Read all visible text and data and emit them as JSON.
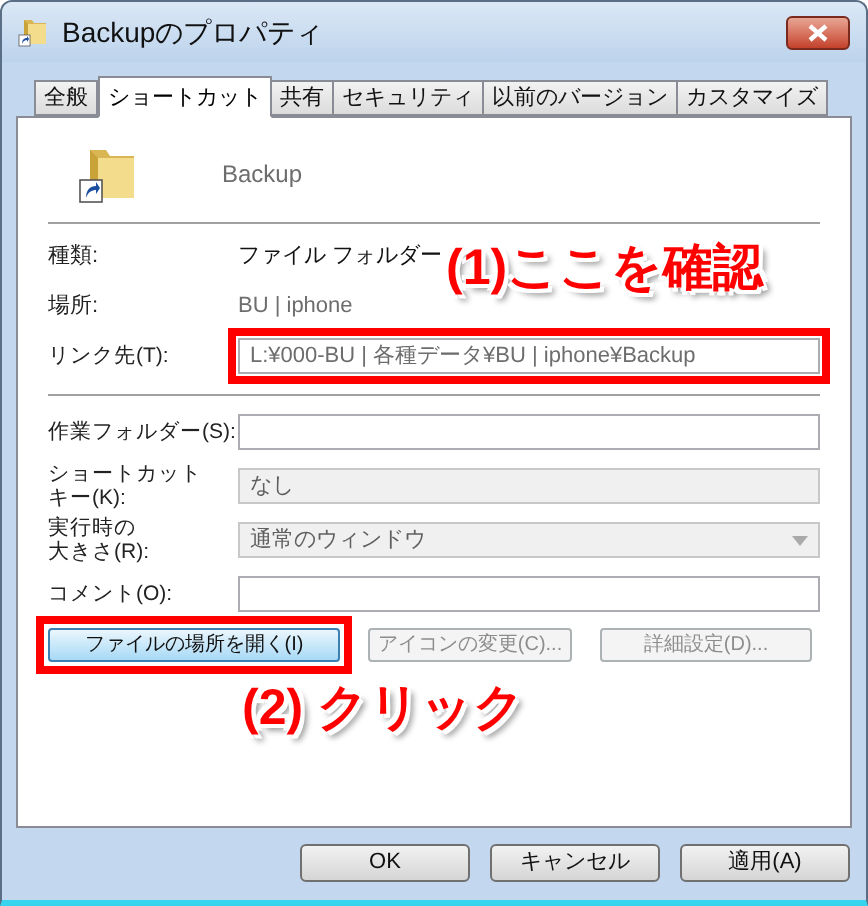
{
  "window": {
    "title": "Backupのプロパティ"
  },
  "tabs": [
    {
      "label": "全般",
      "selected": false
    },
    {
      "label": "ショートカット",
      "selected": true
    },
    {
      "label": "共有",
      "selected": false
    },
    {
      "label": "セキュリティ",
      "selected": false
    },
    {
      "label": "以前のバージョン",
      "selected": false
    },
    {
      "label": "カスタマイズ",
      "selected": false
    }
  ],
  "item": {
    "name": "Backup"
  },
  "properties": [
    {
      "label": "種類:",
      "value": "ファイル フォルダー",
      "dimmed": false
    },
    {
      "label": "場所:",
      "value": "BU | iphone",
      "dimmed": true
    }
  ],
  "fields": [
    {
      "kind": "text",
      "label": [
        "リンク先(T):"
      ],
      "value": "L:¥000-BU | 各種データ¥BU | iphone¥Backup",
      "disabled": false,
      "highlighted": true
    },
    {
      "kind": "text",
      "label": [
        "作業フォルダー(S):"
      ],
      "disabled": false,
      "highlighted": false
    },
    {
      "kind": "text",
      "label": [
        "ショートカット",
        "キー(K):"
      ],
      "value": "なし",
      "disabled": true,
      "highlighted": false
    },
    {
      "kind": "dropdown",
      "label": [
        "実行時の",
        "大きさ(R):"
      ],
      "value": "通常のウィンドウ",
      "disabled": true,
      "highlighted": false
    },
    {
      "kind": "text",
      "label": [
        "コメント(O):"
      ],
      "disabled": false,
      "highlighted": false
    }
  ],
  "actions": [
    {
      "label": "ファイルの場所を開く(I)",
      "disabled": false,
      "highlighted": true
    },
    {
      "label": "アイコンの変更(C)...",
      "disabled": true,
      "highlighted": false
    },
    {
      "label": "詳細設定(D)...",
      "disabled": true,
      "highlighted": false
    }
  ],
  "callouts": [
    {
      "text": "(1)ここを確認"
    },
    {
      "text": "(2) クリック"
    }
  ],
  "buttons": [
    {
      "label": "OK"
    },
    {
      "label": "キャンセル"
    },
    {
      "label": "適用(A)"
    }
  ]
}
